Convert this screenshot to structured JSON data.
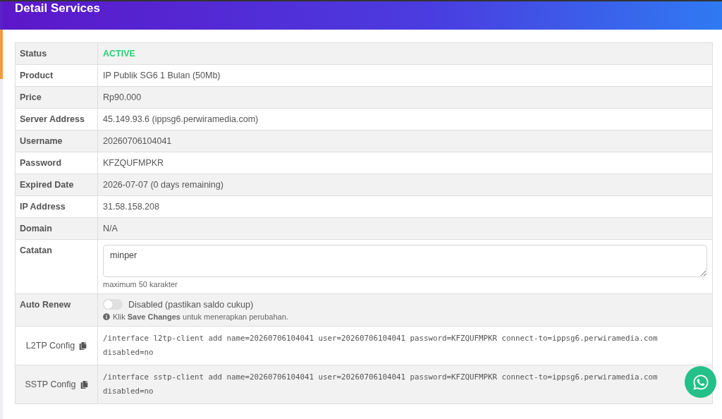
{
  "title": "Detail Services",
  "rows": [
    {
      "kind": "status",
      "label": "Status",
      "value": "ACTIVE"
    },
    {
      "kind": "text",
      "label": "Product",
      "value": "IP Publik SG6 1 Bulan (50Mb)"
    },
    {
      "kind": "text",
      "label": "Price",
      "value": "Rp90.000"
    },
    {
      "kind": "text",
      "label": "Server Address",
      "value": "45.149.93.6 (ippsg6.perwiramedia.com)"
    },
    {
      "kind": "text",
      "label": "Username",
      "value": "20260706104041"
    },
    {
      "kind": "text",
      "label": "Password",
      "value": "KFZQUFMPKR"
    },
    {
      "kind": "text",
      "label": "Expired Date",
      "value": "2026-07-07 (0 days remaining)"
    },
    {
      "kind": "text",
      "label": "IP Address",
      "value": "31.58.158.208"
    },
    {
      "kind": "text",
      "label": "Domain",
      "value": "N/A"
    },
    {
      "kind": "textarea",
      "label": "Catatan",
      "value": "minper",
      "help": "maximum 50 karakter"
    },
    {
      "kind": "toggle",
      "label": "Auto Renew",
      "on": false,
      "value": "Disabled (pastikan saldo cukup)",
      "help": "Klik **Save Changes** untuk menerapkan perubahan."
    },
    {
      "kind": "config",
      "label": "L2TP Config",
      "value": "/interface l2tp-client add name=20260706104041 user=20260706104041 password=KFZQUFMPKR connect-to=ippsg6.perwiramedia.com disabled=no"
    },
    {
      "kind": "config",
      "label": "SSTP Config",
      "value": "/interface sstp-client add name=20260706104041 user=20260706104041 password=KFZQUFMPKR connect-to=ippsg6.perwiramedia.com disabled=no"
    }
  ]
}
